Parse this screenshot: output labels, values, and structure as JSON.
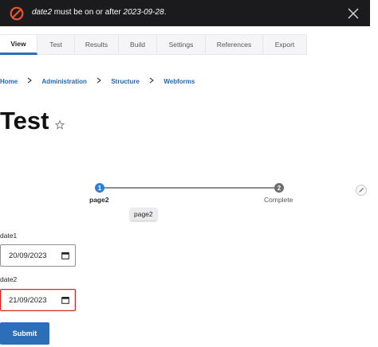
{
  "messages": {
    "error": {
      "field": "date2",
      "text_mid": " must be on or after ",
      "date": "2023-09-28",
      "text_end": "."
    }
  },
  "tabs": [
    {
      "label": "View",
      "active": true
    },
    {
      "label": "Test"
    },
    {
      "label": "Results"
    },
    {
      "label": "Build"
    },
    {
      "label": "Settings"
    },
    {
      "label": "References"
    },
    {
      "label": "Export"
    }
  ],
  "breadcrumb": [
    "Home",
    "Administration",
    "Structure",
    "Webforms"
  ],
  "page": {
    "title": "Test"
  },
  "progress": {
    "steps": [
      {
        "number": "1",
        "label": "page2",
        "current": true
      },
      {
        "number": "2",
        "label": "Complete"
      }
    ],
    "tooltip": "page2"
  },
  "form": {
    "date1": {
      "label": "date1",
      "value": "20/09/2023"
    },
    "date2": {
      "label": "date2",
      "value": "21/09/2023",
      "invalid": true
    },
    "submit_label": "Submit"
  },
  "colors": {
    "accent": "#2c6eb7",
    "error": "#d72222",
    "banner": "#1b1b1d",
    "error_icon": "#e8542e"
  },
  "icons": [
    "error-icon",
    "close-icon",
    "star-icon",
    "pencil-icon",
    "calendar-icon",
    "chevron-right-icon"
  ]
}
